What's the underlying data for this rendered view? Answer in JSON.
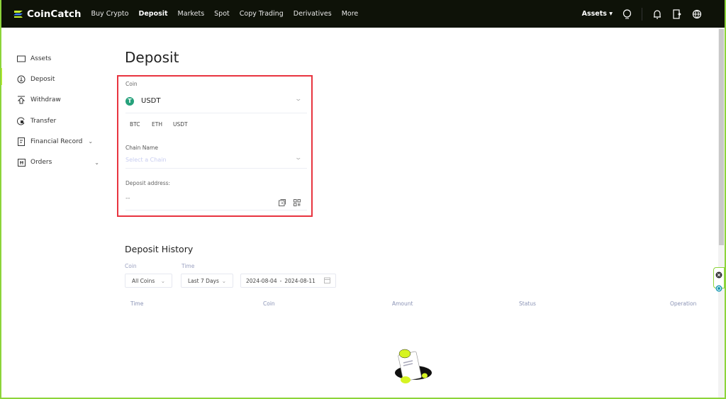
{
  "nav": {
    "brand": "CoinCatch",
    "links": [
      "Buy Crypto",
      "Deposit",
      "Markets",
      "Spot",
      "Copy Trading",
      "Derivatives",
      "More"
    ],
    "active": "Deposit",
    "assets": "Assets"
  },
  "sidebar": {
    "items": [
      {
        "label": "Assets"
      },
      {
        "label": "Deposit"
      },
      {
        "label": "Withdraw"
      },
      {
        "label": "Transfer"
      },
      {
        "label": "Financial Record"
      },
      {
        "label": "Orders"
      }
    ]
  },
  "page": {
    "title": "Deposit"
  },
  "deposit": {
    "coin_label": "Coin",
    "coin_value": "USDT",
    "quick_coins": [
      "BTC",
      "ETH",
      "USDT"
    ],
    "chain_label": "Chain Name",
    "chain_placeholder": "Select a Chain",
    "address_label": "Deposit address:",
    "address_value": "--"
  },
  "history": {
    "title": "Deposit History",
    "coin_label": "Coin",
    "coin_value": "All Coins",
    "time_label": "Time",
    "time_value": "Last 7 Days",
    "date_start": "2024-08-04",
    "date_sep": "-",
    "date_end": "2024-08-11",
    "columns": [
      "Time",
      "Coin",
      "Amount",
      "Status",
      "Operation"
    ]
  },
  "colors": {
    "accent": "#c6f432",
    "nav_bg": "#0e1208",
    "highlight": "#e8343f",
    "tether": "#26a17b"
  }
}
